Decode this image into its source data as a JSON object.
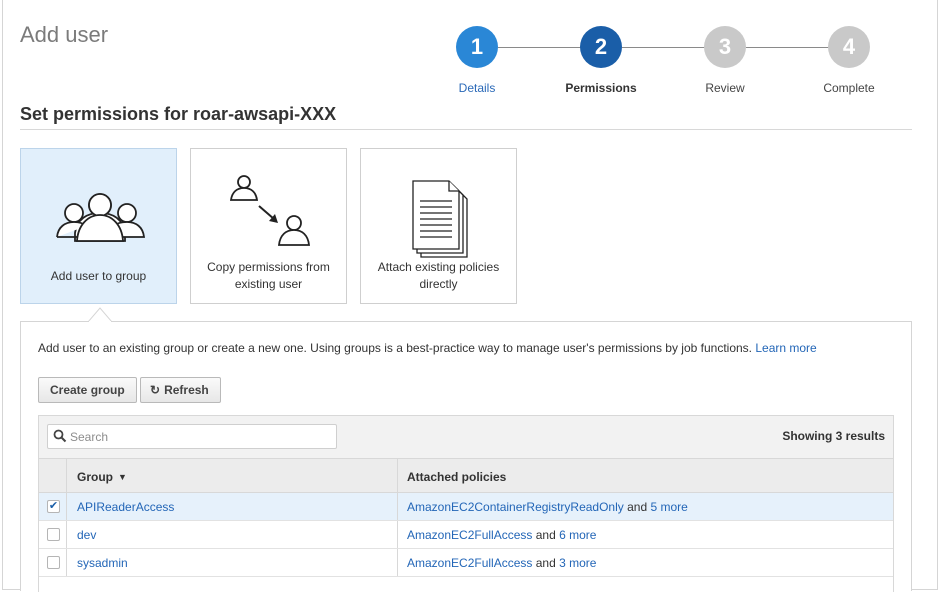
{
  "page": {
    "title": "Add user"
  },
  "stepper": {
    "steps": [
      {
        "number": "1",
        "label": "Details",
        "state": "done"
      },
      {
        "number": "2",
        "label": "Permissions",
        "state": "current"
      },
      {
        "number": "3",
        "label": "Review",
        "state": "upcoming"
      },
      {
        "number": "4",
        "label": "Complete",
        "state": "upcoming"
      }
    ]
  },
  "section": {
    "title": "Set permissions for roar-awsapi-XXX"
  },
  "options": [
    {
      "label": "Add user to group",
      "selected": true,
      "icon": "users-group-icon"
    },
    {
      "label": "Copy permissions from existing user",
      "selected": false,
      "icon": "copy-user-icon"
    },
    {
      "label": "Attach existing policies directly",
      "selected": false,
      "icon": "document-stack-icon"
    }
  ],
  "panel": {
    "intro": "Add user to an existing group or create a new one. Using groups is a best-practice way to manage user's permissions by job functions.",
    "learn_more": "Learn more",
    "create_group_label": "Create group",
    "refresh_label": "Refresh",
    "search_placeholder": "Search",
    "results_text": "Showing 3 results",
    "columns": {
      "group": "Group",
      "policies": "Attached policies"
    },
    "rows": [
      {
        "name": "APIReaderAccess",
        "policy": "AmazonEC2ContainerRegistryReadOnly",
        "and": "and",
        "more": "5 more",
        "checked": true
      },
      {
        "name": "dev",
        "policy": "AmazonEC2FullAccess",
        "and": "and",
        "more": "6 more",
        "checked": false
      },
      {
        "name": "sysadmin",
        "policy": "AmazonEC2FullAccess",
        "and": "and",
        "more": "3 more",
        "checked": false
      }
    ]
  },
  "colors": {
    "accent": "#2a87d6",
    "accent_dark": "#1a5ea8",
    "link": "#2366b7",
    "selected_bg": "#e1effb",
    "inactive_step": "#c9c9c9"
  }
}
